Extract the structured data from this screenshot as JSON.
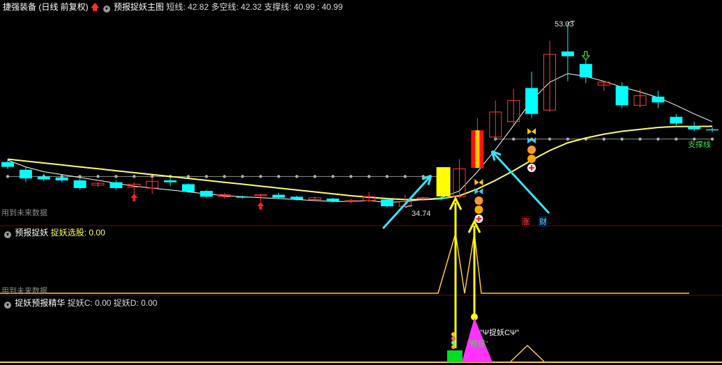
{
  "main_header": {
    "title": "捷强装备 (日线 前复权)",
    "up_arrow_icon": "red-up-arrow",
    "indicator_name": "预报捉妖主图",
    "short_label": "短线:",
    "short_value": "42.82",
    "mid_label": "多空线:",
    "mid_value": "42.32",
    "support_label": "支撑线:",
    "support_value": "40.99 : 40.99"
  },
  "panel2_header": {
    "name": "预报捉妖",
    "field_label": "捉妖选股:",
    "field_value": "0.00"
  },
  "panel3_header": {
    "name": "捉妖预报精华",
    "c_label": "捉妖C:",
    "c_value": "0.00",
    "d_label": "捉妖D:",
    "d_value": "0.00"
  },
  "notes": {
    "future_data_1": "用到未来数据",
    "future_data_2": "用到未来数据"
  },
  "labels": {
    "high_price": "53.03",
    "low_price": "34.74",
    "support_line": "支撑线",
    "zhang": "涨",
    "cai": "财",
    "zhuoyao_c": "\"Ψ捉妖CΨ\"",
    "yubao": "\"预报\""
  },
  "colors": {
    "background": "#000000",
    "up_candle": "#ff3b3b",
    "down_candle": "#00ffff",
    "signal_yellow": "#ffff00",
    "magenta": "#ff33ff",
    "grid_dot": "#b0b0b0",
    "support_line": "#ffff66",
    "label_green": "#44dd44"
  },
  "chart_data": {
    "type": "candlestick",
    "candles": [
      {
        "o": 38.6,
        "h": 38.9,
        "c": 38.1,
        "l": 37.9
      },
      {
        "o": 37.8,
        "h": 38.1,
        "c": 36.9,
        "l": 36.5
      },
      {
        "o": 37.1,
        "h": 37.4,
        "c": 36.8,
        "l": 36.6
      },
      {
        "o": 37.0,
        "h": 37.2,
        "c": 36.7,
        "l": 36.5
      },
      {
        "o": 36.7,
        "h": 36.9,
        "c": 35.9,
        "l": 35.7
      },
      {
        "o": 36.2,
        "h": 36.5,
        "c": 36.4,
        "l": 36.0
      },
      {
        "o": 36.5,
        "h": 36.7,
        "c": 35.9,
        "l": 35.7
      },
      {
        "o": 36.0,
        "h": 36.5,
        "c": 36.3,
        "l": 35.2
      },
      {
        "o": 35.9,
        "h": 36.9,
        "c": 36.6,
        "l": 35.3
      },
      {
        "o": 36.7,
        "h": 36.9,
        "c": 36.5,
        "l": 36.1
      },
      {
        "o": 36.3,
        "h": 36.4,
        "c": 35.5,
        "l": 35.4
      },
      {
        "o": 35.6,
        "h": 35.7,
        "c": 35.0,
        "l": 34.9
      },
      {
        "o": 35.0,
        "h": 35.4,
        "c": 35.2,
        "l": 34.8
      },
      {
        "o": 35.0,
        "h": 35.1,
        "c": 34.9,
        "l": 34.8
      },
      {
        "o": 35.1,
        "h": 35.3,
        "c": 35.2,
        "l": 34.5
      },
      {
        "o": 35.2,
        "h": 35.4,
        "c": 34.9,
        "l": 34.8
      },
      {
        "o": 35.0,
        "h": 35.1,
        "c": 34.7,
        "l": 34.6
      },
      {
        "o": 34.7,
        "h": 35.0,
        "c": 34.9,
        "l": 34.5
      },
      {
        "o": 34.8,
        "h": 34.9,
        "c": 34.5,
        "l": 34.4
      },
      {
        "o": 34.5,
        "h": 34.8,
        "c": 34.6,
        "l": 34.3
      },
      {
        "o": 34.6,
        "h": 35.5,
        "c": 35.0,
        "l": 34.4
      },
      {
        "o": 34.7,
        "h": 34.9,
        "c": 34.0,
        "l": 33.9
      },
      {
        "o": 34.0,
        "h": 35.2,
        "c": 34.5,
        "l": 33.9
      },
      {
        "o": 34.8,
        "h": 35.0,
        "c": 34.9,
        "l": 34.6
      },
      {
        "o": 34.9,
        "h": 35.0,
        "c": 34.8,
        "l": 34.6
      },
      {
        "o": 35.0,
        "h": 38.9,
        "c": 37.9,
        "l": 34.9
      },
      {
        "o": 38.0,
        "h": 43.2,
        "c": 41.9,
        "l": 37.9
      },
      {
        "o": 41.2,
        "h": 45.0,
        "c": 43.8,
        "l": 40.9
      },
      {
        "o": 42.8,
        "h": 46.2,
        "c": 45.0,
        "l": 42.5
      },
      {
        "o": 46.3,
        "h": 48.0,
        "c": 43.6,
        "l": 43.2
      },
      {
        "o": 44.0,
        "h": 51.2,
        "c": 49.8,
        "l": 43.8
      },
      {
        "o": 50.1,
        "h": 53.03,
        "c": 49.6,
        "l": 47.0
      },
      {
        "o": 48.8,
        "h": 49.2,
        "c": 47.4,
        "l": 46.8
      },
      {
        "o": 46.6,
        "h": 47.0,
        "c": 46.9,
        "l": 46.0
      },
      {
        "o": 46.5,
        "h": 46.9,
        "c": 44.5,
        "l": 44.2
      },
      {
        "o": 44.5,
        "h": 46.2,
        "c": 45.5,
        "l": 44.3
      },
      {
        "o": 45.4,
        "h": 46.0,
        "c": 44.8,
        "l": 44.2
      },
      {
        "o": 43.3,
        "h": 43.6,
        "c": 42.6,
        "l": 42.4
      },
      {
        "o": 42.3,
        "h": 42.8,
        "c": 42.0,
        "l": 41.8
      },
      {
        "o": 42.0,
        "h": 42.2,
        "c": 41.9,
        "l": 41.7
      }
    ],
    "short_line": [
      38.8,
      38.1,
      37.6,
      37.3,
      37.0,
      36.7,
      36.4,
      36.1,
      35.9,
      35.7,
      35.5,
      35.3,
      35.1,
      35.0,
      34.9,
      34.8,
      34.7,
      34.6,
      34.5,
      34.5,
      34.6,
      34.4,
      34.5,
      34.7,
      34.9,
      35.6,
      37.6,
      39.9,
      42.4,
      45.0,
      46.9,
      47.8,
      47.5,
      47.0,
      46.4,
      45.9,
      45.3,
      44.5,
      43.6,
      42.8
    ],
    "mid_line": [
      38.9,
      38.7,
      38.5,
      38.3,
      38.1,
      37.9,
      37.7,
      37.5,
      37.3,
      37.1,
      36.9,
      36.7,
      36.5,
      36.3,
      36.1,
      35.9,
      35.7,
      35.5,
      35.3,
      35.1,
      34.95,
      34.8,
      34.7,
      34.7,
      34.8,
      35.1,
      35.8,
      36.7,
      37.7,
      38.8,
      39.8,
      40.6,
      41.1,
      41.5,
      41.8,
      42.0,
      42.2,
      42.3,
      42.3,
      42.32
    ],
    "support_dots": [
      37.1,
      37.1,
      37.1,
      37.1,
      37.1,
      37.1,
      37.1,
      37.1,
      37.1,
      37.1,
      37.1,
      37.1,
      37.1,
      37.1,
      37.1,
      37.1,
      37.1,
      37.1,
      37.1,
      37.1,
      37.1,
      37.1,
      37.1,
      37.1,
      37.1,
      null,
      null,
      40.99,
      40.99,
      40.99,
      40.99,
      40.99,
      40.99,
      40.99,
      40.99,
      40.99,
      40.99,
      40.99,
      40.99,
      40.99
    ],
    "high_label_value": 53.03,
    "low_label_value": 34.74,
    "up_arrows_at": [
      7,
      14
    ],
    "down_arrow_at": 32
  }
}
